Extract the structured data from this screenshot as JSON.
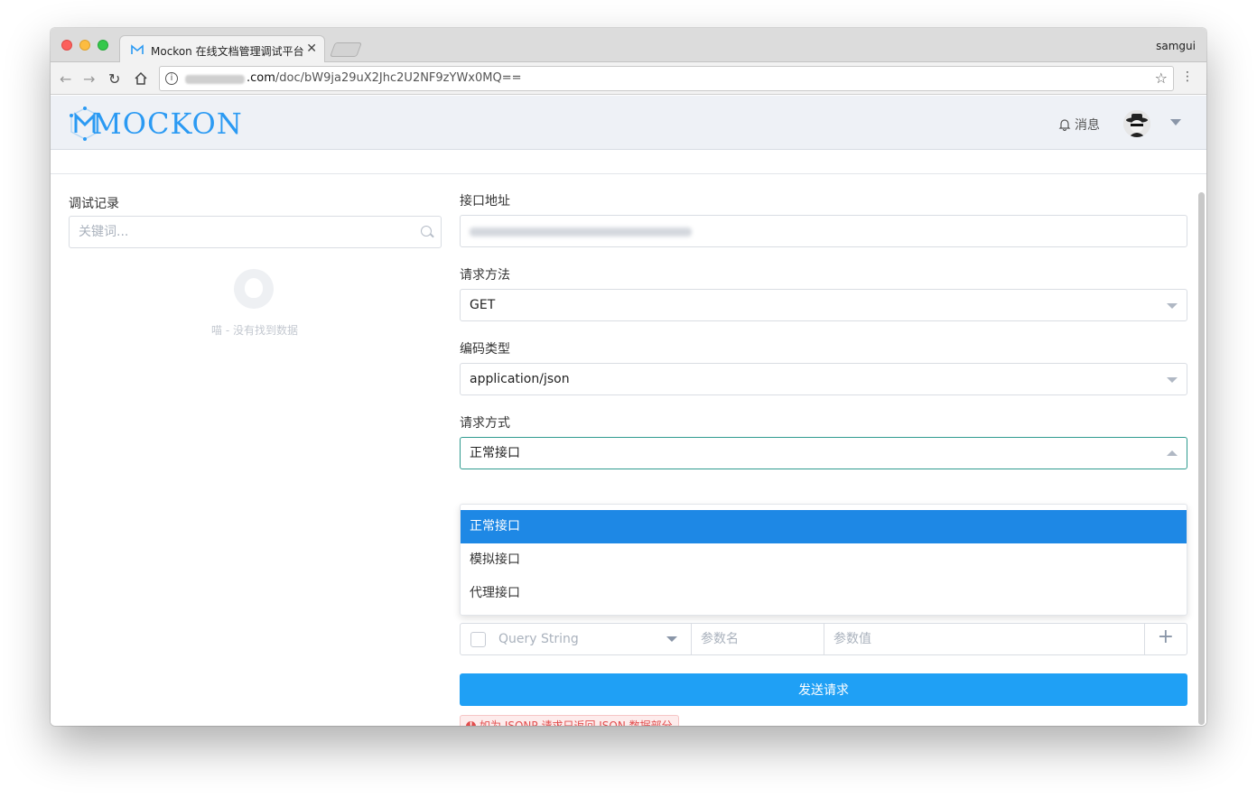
{
  "browser": {
    "tab_title": "Mockon 在线文档管理调试平台",
    "tab_close": "✕",
    "user": "samgui",
    "url_domain_suffix": ".com",
    "url_path": "/doc/bW9ja29uX2Jhc2U2NF9zYWx0MQ=="
  },
  "header": {
    "logo_text": "MOCKON",
    "message_label": "消息"
  },
  "left": {
    "label": "调试记录",
    "search_placeholder": "关键词...",
    "empty_text": "喵 - 没有找到数据"
  },
  "form": {
    "url_label": "接口地址",
    "method_label": "请求方法",
    "method_value": "GET",
    "encoding_label": "编码类型",
    "encoding_value": "application/json",
    "mode_label": "请求方式",
    "mode_value": "正常接口",
    "mode_options": [
      "正常接口",
      "模拟接口",
      "代理接口"
    ],
    "param_type": "Query String",
    "param_name_placeholder": "参数名",
    "param_value_placeholder": "参数值",
    "add_icon": "+",
    "send_label": "发送请求",
    "tip_text": "如为 JSONP 请求只返回 JSON 数据部分",
    "tip_icon": "!"
  },
  "colors": {
    "accent": "#1fa0f5",
    "active_option": "#1e88e5",
    "tip": "#e24d4d"
  }
}
